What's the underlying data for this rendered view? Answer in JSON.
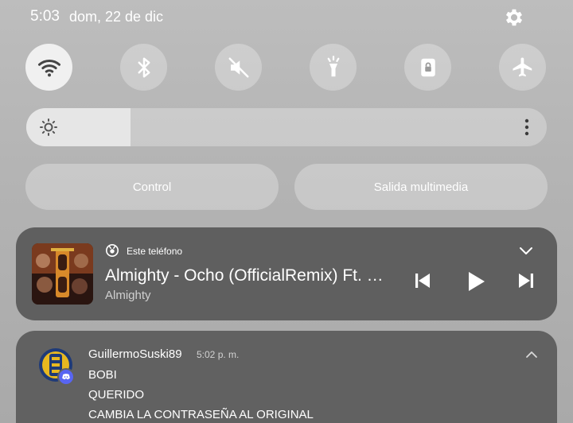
{
  "status": {
    "time": "5:03",
    "date": "dom, 22 de dic"
  },
  "quick_settings": [
    {
      "icon": "wifi-icon",
      "active": true
    },
    {
      "icon": "bluetooth-icon",
      "active": false
    },
    {
      "icon": "sound-muted-icon",
      "active": false
    },
    {
      "icon": "flashlight-icon",
      "active": false
    },
    {
      "icon": "rotation-lock-icon",
      "active": false
    },
    {
      "icon": "airplane-mode-icon",
      "active": false
    }
  ],
  "brightness": {
    "level": 0.2
  },
  "pills": {
    "control": "Control",
    "media_output": "Salida multimedia"
  },
  "media": {
    "source": "Este teléfono",
    "title": "Almighty - Ocho (OfficialRemix) Ft. …",
    "artist": "Almighty"
  },
  "notification": {
    "sender": "GuillermoSuski89",
    "time": "5:02 p. m.",
    "lines": [
      "BOBI",
      "QUERIDO",
      "CAMBIA LA CONTRASEÑA AL ORIGINAL"
    ]
  },
  "colors": {
    "accent_discord": "#5865f2",
    "media_card": "#5f5f5f"
  }
}
